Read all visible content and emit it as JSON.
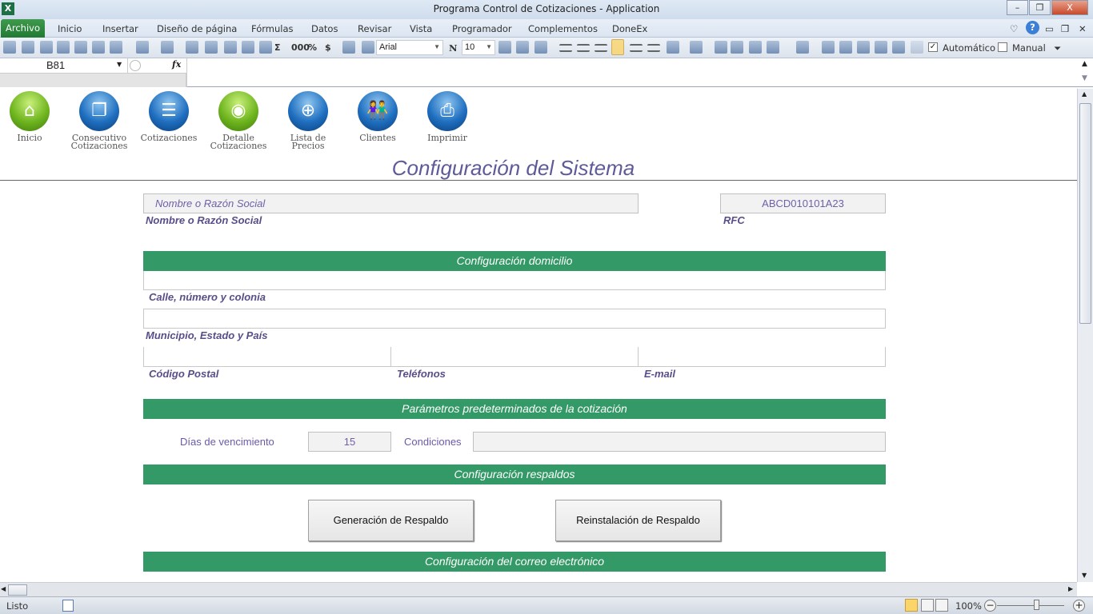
{
  "window": {
    "title": "Programa Control de Cotizaciones - Application",
    "app_logo": "X",
    "min": "–",
    "restore": "❐",
    "close": "X"
  },
  "menu": {
    "tabs": [
      "Archivo",
      "Inicio",
      "Insertar",
      "Diseño de página",
      "Fórmulas",
      "Datos",
      "Revisar",
      "Vista",
      "Programador",
      "Complementos",
      "DoneEx"
    ],
    "right_icons": [
      "heart-icon",
      "help-icon",
      "minimize-icon",
      "restore-icon",
      "close-icon"
    ]
  },
  "toolbar": {
    "icons_left": [
      "open-icon",
      "paste-icon",
      "new-icon",
      "save-icon",
      "print-icon",
      "print-preview-icon",
      "undo-icon",
      "redo-icon",
      "format-icon",
      "insert-rows-icon",
      "delete-rows-icon",
      "insert-cols-icon",
      "delete-cols-icon",
      "image-icon",
      "sum-icon",
      "thousands-icon",
      "percent-icon",
      "currency-icon",
      "increase-decimal-icon",
      "decrease-decimal-icon"
    ],
    "sum": "Σ",
    "thousands": "000",
    "percent": "%",
    "currency": "$",
    "font": "Arial",
    "bold": "N",
    "size": "10",
    "icons_right": [
      "preview-icon",
      "zoom-icon",
      "merge-icon",
      "align-left-icon",
      "align-center-icon",
      "align-right-icon",
      "align-bottom-icon",
      "align-middle-icon",
      "align-top-icon",
      "borders-icon",
      "line-color-icon",
      "eraser-icon",
      "row-height-icon",
      "col-width-icon",
      "font-color-icon",
      "fill-color-icon",
      "copy-format-icon",
      "brush-icon",
      "sheet-icon",
      "chart-icon",
      "ruler-icon",
      "lock-icon"
    ],
    "auto_checked": true,
    "auto_label": "Automático",
    "manual_checked": false,
    "manual_label": "Manual"
  },
  "formula": {
    "cell": "B81",
    "fx": "fx",
    "value": ""
  },
  "nav": [
    {
      "label": "Inicio",
      "icon": "home-icon",
      "color": "g",
      "glyph": "⌂"
    },
    {
      "label": "Consecutivo Cotizaciones",
      "icon": "documents-icon",
      "color": "b",
      "glyph": "❐"
    },
    {
      "label": "Cotizaciones",
      "icon": "document-icon",
      "color": "b",
      "glyph": "☰"
    },
    {
      "label": "Detalle Cotizaciones",
      "icon": "disc-icon",
      "color": "g",
      "glyph": "◉"
    },
    {
      "label": "Lista de Precios",
      "icon": "target-icon",
      "color": "b",
      "glyph": "⊕"
    },
    {
      "label": "Clientes",
      "icon": "people-icon",
      "color": "b",
      "glyph": "👫"
    },
    {
      "label": "Imprimir",
      "icon": "printer-icon",
      "color": "b",
      "glyph": "⎙"
    }
  ],
  "page": {
    "title": "Configuración del Sistema",
    "name_value": "Nombre o Razón Social",
    "name_label": "Nombre o Razón Social",
    "rfc_value": "ABCD010101A23",
    "rfc_label": "RFC",
    "sec_domicilio": "Configuración domicilio",
    "calle_label": "Calle, número y colonia",
    "municipio_label": "Municipio, Estado y País",
    "cp_label": "Código Postal",
    "tel_label": "Teléfonos",
    "email_label": "E-mail",
    "sec_parametros": "Parámetros predeterminados de la cotización",
    "dias_label": "Días de vencimiento",
    "dias_value": "15",
    "condiciones_label": "Condiciones",
    "condiciones_value": "",
    "sec_respaldos": "Configuración respaldos",
    "btn_generar": "Generación  de Respaldo",
    "btn_reinstalar": "Reinstalación  de Respaldo",
    "sec_correo": "Configuración del correo electrónico"
  },
  "status": {
    "text": "Listo",
    "zoom": "100%",
    "zoom_level": 100,
    "minus": "−",
    "plus": "+"
  },
  "colors": {
    "band": "#339966",
    "label": "#594d8a",
    "title": "#5e5a9a"
  }
}
